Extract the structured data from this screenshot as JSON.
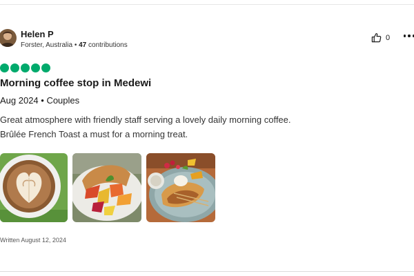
{
  "review": {
    "user": {
      "name": "Helen P",
      "location": "Forster, Australia",
      "separator": "•",
      "contributions_count": "47",
      "contributions_label": "contributions",
      "avatar_icon": "user-avatar-photo"
    },
    "actions": {
      "like_icon": "thumbs-up-icon",
      "like_count": "0",
      "more_icon": "more-horizontal-icon"
    },
    "rating": {
      "value": 5,
      "max": 5,
      "color": "#00aa6c"
    },
    "title": "Morning coffee stop in Medewi",
    "date_line": "Aug 2024 • Couples",
    "body_lines": [
      "Great atmosphere with friendly staff serving a lovely daily morning coffee.",
      "Brûlée French Toast a must for a morning treat."
    ],
    "photos": [
      {
        "icon": "latte-art-photo"
      },
      {
        "icon": "fruit-plate-photo"
      },
      {
        "icon": "french-toast-photo"
      }
    ],
    "written": "Written August 12, 2024"
  }
}
